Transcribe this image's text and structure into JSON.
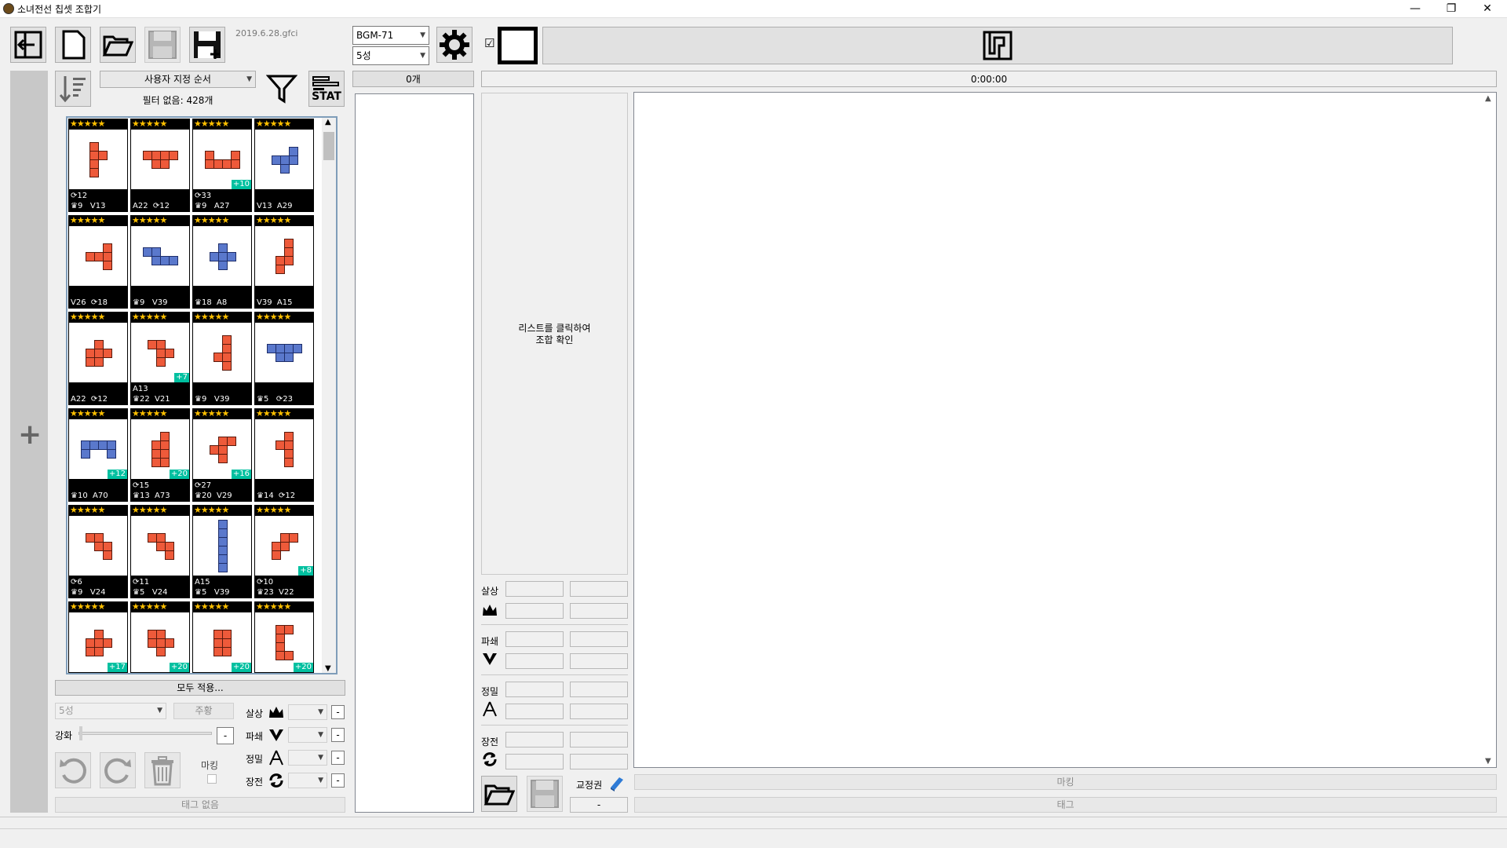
{
  "window": {
    "title": "소녀전선 칩셋 조합기",
    "minimize": "—",
    "maximize": "❐",
    "close": "✕"
  },
  "toolbar": {
    "version": "2019.6.28.gfci",
    "gun_select": "BGM-71",
    "star_select": "5성",
    "count": "0개",
    "timer": "0:00:00",
    "checkbox": "☑"
  },
  "left": {
    "sort_select": "사용자 지정 순서",
    "filter_status": "필터 없음: 428개",
    "stat_icon_text": "STAT",
    "apply_all": "모두 적용...",
    "star_edit": "5성",
    "color_btn": "주황",
    "enhance_label": "강화",
    "enhance_minus": "-",
    "stats": [
      {
        "label": "살상",
        "minus": "-"
      },
      {
        "label": "파쇄",
        "minus": "-"
      },
      {
        "label": "정밀",
        "minus": "-"
      },
      {
        "label": "장전",
        "minus": "-"
      }
    ],
    "mark_label": "마킹",
    "tag_none": "태그 없음"
  },
  "chips": [
    {
      "stars": "★★★★★",
      "stat": "⟳12\n♛9   V13",
      "color": "o",
      "plus": ""
    },
    {
      "stars": "★★★★★",
      "stat": "A22  ⟳12",
      "color": "o",
      "plus": ""
    },
    {
      "stars": "★★★★★",
      "stat": "⟳33\n♛9   A27",
      "color": "o",
      "plus": "+10"
    },
    {
      "stars": "★★★★★",
      "stat": "V13  A29",
      "color": "b",
      "plus": ""
    },
    {
      "stars": "★★★★★",
      "stat": "V26  ⟳18",
      "color": "o",
      "plus": ""
    },
    {
      "stars": "★★★★★",
      "stat": "♛9   V39",
      "color": "b",
      "plus": ""
    },
    {
      "stars": "★★★★★",
      "stat": "♛18  A8",
      "color": "b",
      "plus": ""
    },
    {
      "stars": "★★★★★",
      "stat": "V39  A15",
      "color": "o",
      "plus": ""
    },
    {
      "stars": "★★★★★",
      "stat": "A22  ⟳12",
      "color": "o",
      "plus": ""
    },
    {
      "stars": "★★★★★",
      "stat": "A13\n♛22  V21",
      "color": "o",
      "plus": "+7"
    },
    {
      "stars": "★★★★★",
      "stat": "♛9   V39",
      "color": "o",
      "plus": ""
    },
    {
      "stars": "★★★★★",
      "stat": "♛5   ⟳23",
      "color": "b",
      "plus": ""
    },
    {
      "stars": "★★★★★",
      "stat": "♛10  A70",
      "color": "b",
      "plus": "+12"
    },
    {
      "stars": "★★★★★",
      "stat": "⟳15\n♛13  A73",
      "color": "o",
      "plus": "+20"
    },
    {
      "stars": "★★★★★",
      "stat": "⟳27\n♛20  V29",
      "color": "o",
      "plus": "+16"
    },
    {
      "stars": "★★★★★",
      "stat": "♛14  ⟳12",
      "color": "o",
      "plus": ""
    },
    {
      "stars": "★★★★★",
      "stat": "⟳6\n♛9   V24",
      "color": "o",
      "plus": ""
    },
    {
      "stars": "★★★★★",
      "stat": "⟳11\n♛5   V24",
      "color": "o",
      "plus": ""
    },
    {
      "stars": "★★★★★",
      "stat": "A15\n♛5   V39",
      "color": "b",
      "plus": ""
    },
    {
      "stars": "★★★★★",
      "stat": "⟳10\n♛23  V22",
      "color": "o",
      "plus": "+8"
    },
    {
      "stars": "★★★★★",
      "stat": "",
      "color": "o",
      "plus": "+17"
    },
    {
      "stars": "★★★★★",
      "stat": "",
      "color": "o",
      "plus": "+20"
    },
    {
      "stars": "★★★★★",
      "stat": "",
      "color": "o",
      "plus": "+20"
    },
    {
      "stars": "★★★★★",
      "stat": "",
      "color": "o",
      "plus": "+20"
    }
  ],
  "middle": {
    "hint_line1": "리스트를 클릭하여",
    "hint_line2": "조합 확인",
    "stats": [
      "살상",
      "파쇄",
      "정밀",
      "장전"
    ],
    "ticket_label": "교정권",
    "ticket_value": "-"
  },
  "right": {
    "mark_btn": "마킹",
    "tag_btn": "태그"
  }
}
